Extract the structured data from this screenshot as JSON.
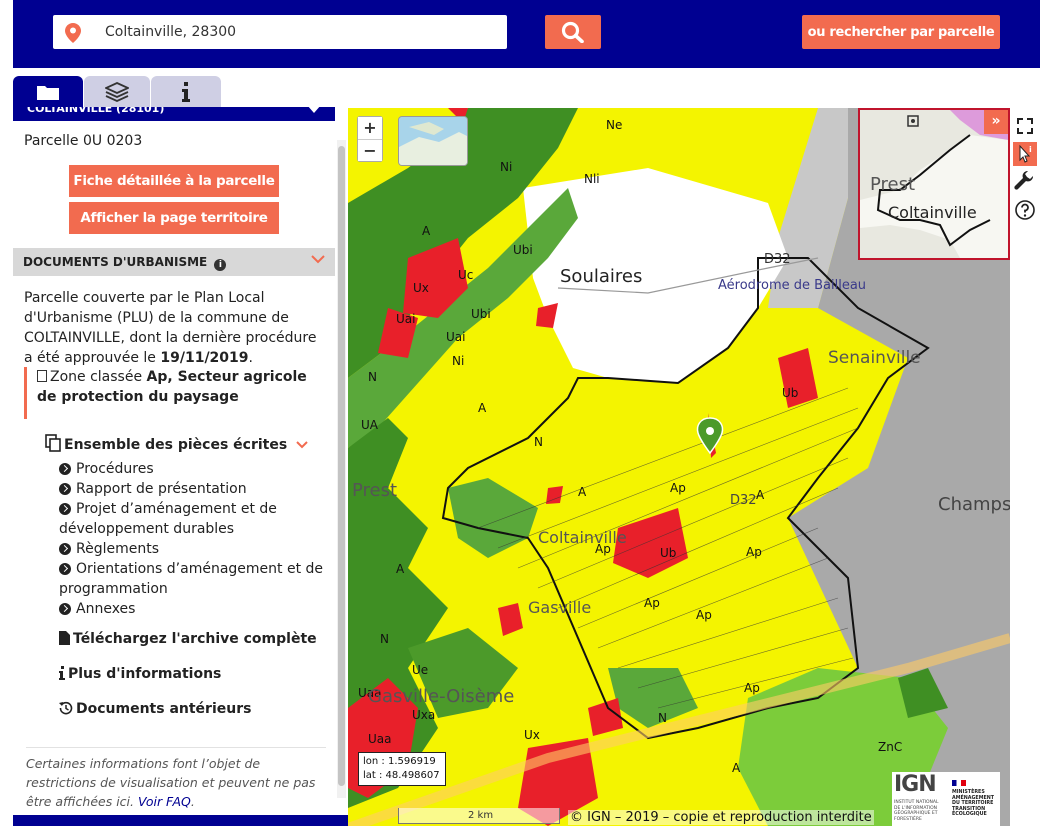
{
  "header": {
    "search_value": "Coltainville, 28300",
    "search_placeholder": "",
    "search_button_icon": "search-icon",
    "parcel_search_label": "ou rechercher par parcelle"
  },
  "tabs": [
    {
      "icon": "folder-icon",
      "active": true
    },
    {
      "icon": "layers-icon",
      "active": false
    },
    {
      "icon": "info-icon",
      "active": false
    }
  ],
  "panel": {
    "commune_title": "COLTAINVILLE (28101)",
    "parcel_label": "Parcelle 0U 0203",
    "btn_fiche": "Fiche détaillée à la parcelle",
    "btn_territoire": "Afficher la page territoire",
    "docs_section_title": "DOCUMENTS D'URBANISME",
    "desc_part1": "Parcelle couverte par le Plan Local d'Urbanisme (PLU) de la commune de COLTAINVILLE, dont la dernière procédure a été approuvée le ",
    "desc_date": "19/11/2019",
    "desc_end": ".",
    "zone_prefix": "Zone classée ",
    "zone_code": "Ap",
    "zone_label": ", Secteur agricole de protection du paysage",
    "pieces_title": "Ensemble des pièces écrites",
    "pieces": [
      "Procédures",
      "Rapport de présentation",
      "Projet d’aménagement et de développement durables",
      "Règlements",
      "Orientations d’aménagement et de programmation",
      "Annexes"
    ],
    "archive_link": "Téléchargez l'archive complète",
    "more_info_link": "Plus d'informations",
    "old_docs_link": "Documents antérieurs",
    "footnote": "Certaines informations font l’objet de restrictions de visualisation et peuvent ne pas être affichées ici.",
    "faq_link": "Voir FAQ",
    "footnote_end": "."
  },
  "map": {
    "zoom_in": "+",
    "zoom_out": "−",
    "place_labels": [
      "Soulaires",
      "Aérodrome de Bailleau",
      "Senainville",
      "Champs",
      "Prest",
      "Coltainville",
      "Gasville",
      "Gasville-Oisème",
      "D32",
      "D32"
    ],
    "overview_labels": [
      "Prest",
      "Coltainville"
    ],
    "overview_collapse": "»",
    "lon_label": "lon : 1.596919",
    "lat_label": "lat : 48.498607",
    "scale_label": "2 km",
    "attribution": "© IGN – 2019 – copie et reproduction interdite",
    "ign_logo": "IGN",
    "ign_subtitle": "INSTITUT NATIONAL DE L'INFORMATION GÉOGRAPHIQUE ET FORESTIÈRE",
    "ministry_logo": "MINISTÈRES AMÉNAGEMENT DU TERRITOIRE TRANSITION ÉCOLOGIQUE",
    "zones": [
      "A",
      "N",
      "Ap",
      "Ub",
      "Uc",
      "Ux",
      "Uai",
      "Ubi",
      "Ni",
      "Ne",
      "Nli",
      "UA",
      "Ue",
      "Uaa",
      "Uxa",
      "ZnC"
    ]
  },
  "colors": {
    "brand_blue": "#000091",
    "accent_orange": "#f26b4f",
    "zone_agricultural": "#ffff00",
    "zone_natural": "#4c9a2a",
    "zone_urban": "#e8202a",
    "inactive_tab": "#cfcfe4"
  }
}
